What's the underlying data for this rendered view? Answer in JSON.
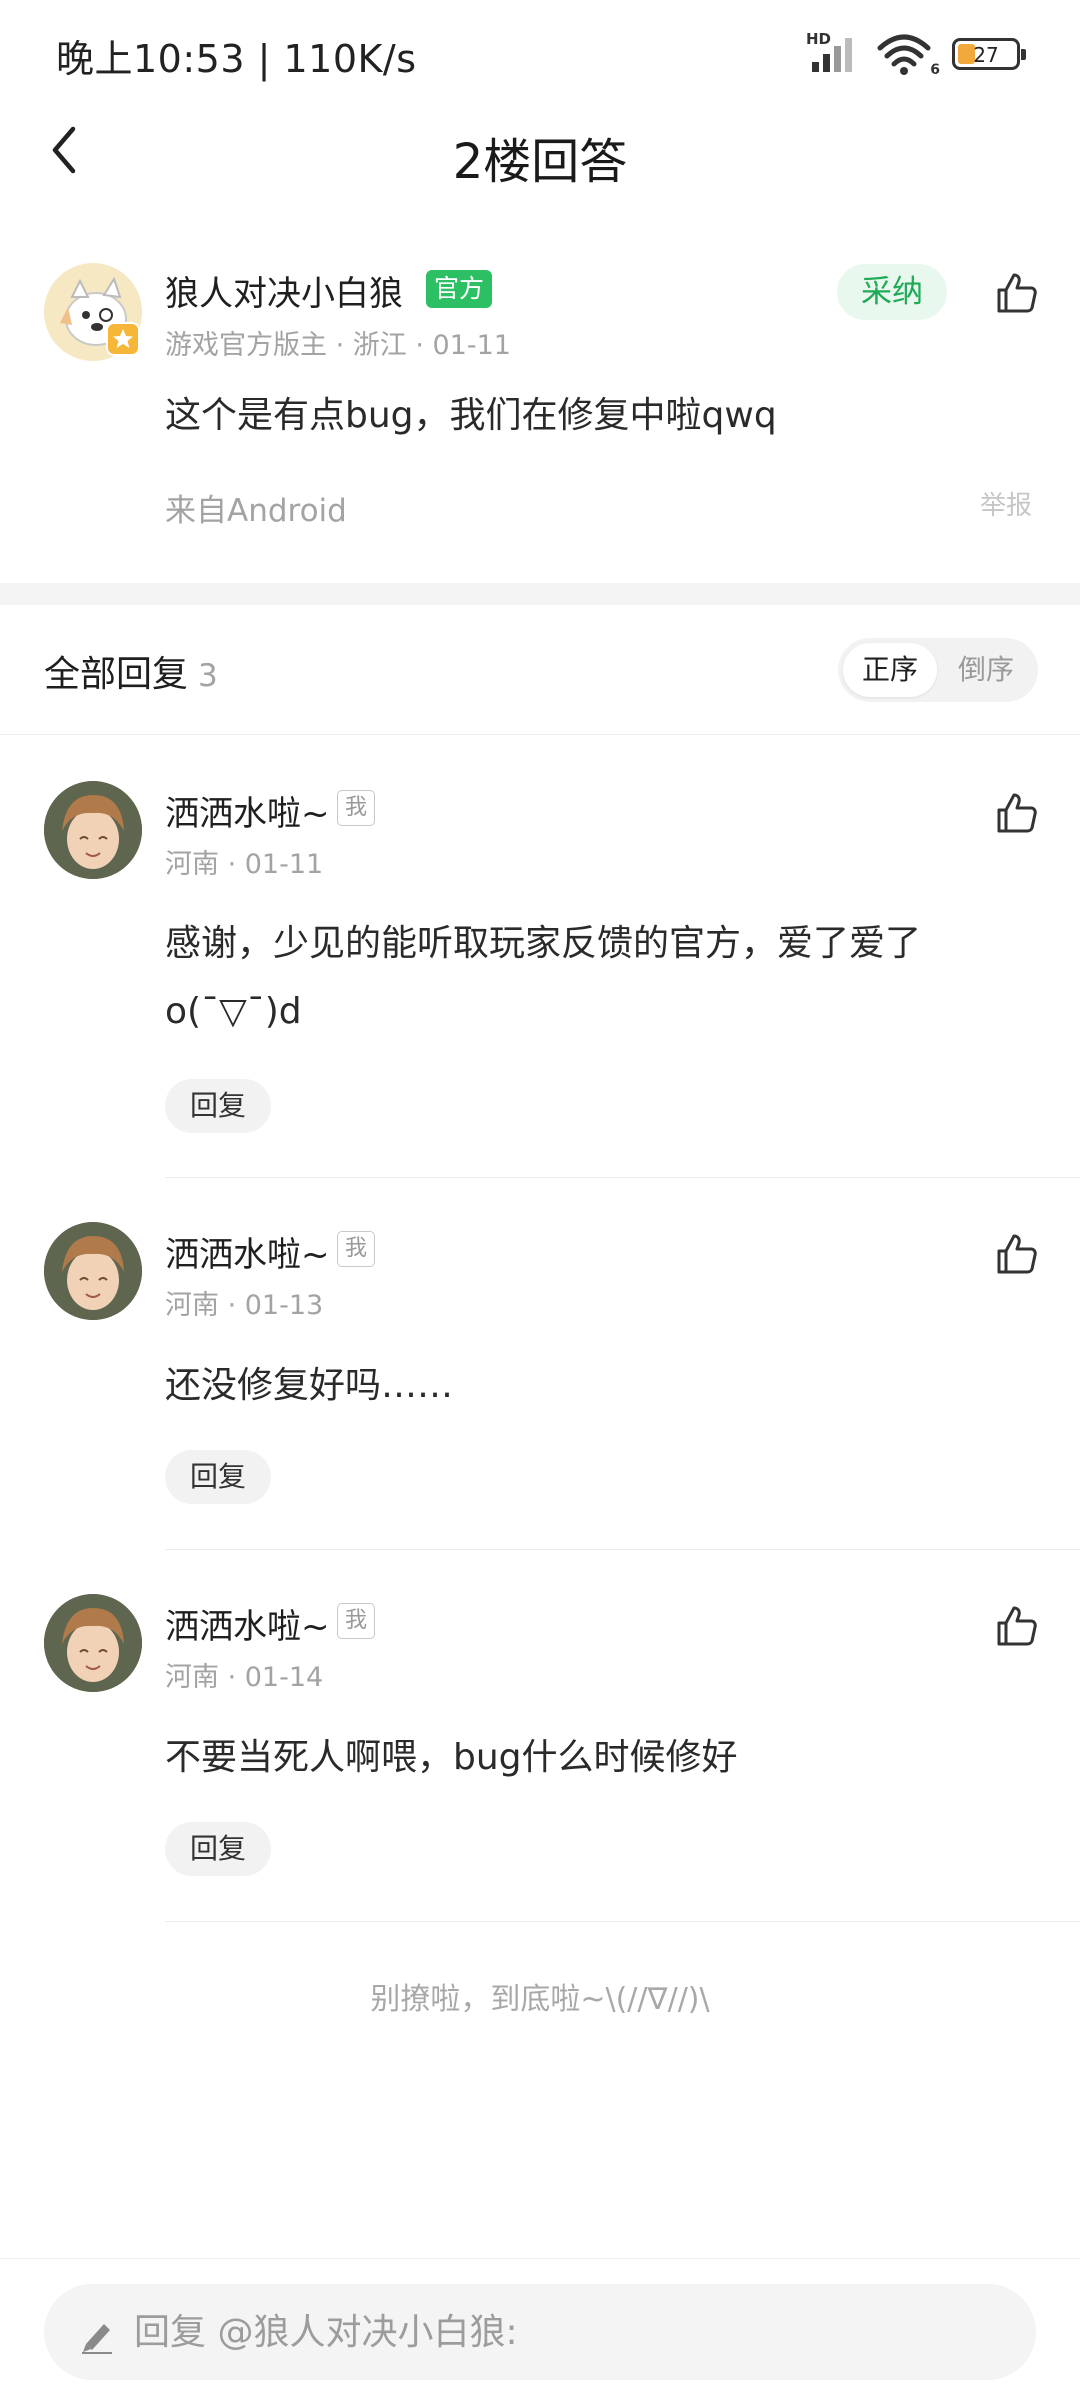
{
  "status_bar": {
    "time": "晚上10:53 | 110K/s",
    "network_badge": "HD",
    "wifi_badge": "6",
    "battery": "27"
  },
  "header": {
    "title": "2楼回答"
  },
  "answer": {
    "author": "狼人对决小白狼",
    "official_badge": "官方",
    "meta": "游戏官方版主 · 浙江 · 01-11",
    "content": "这个是有点bug，我们在修复中啦qwq",
    "source": "来自Android",
    "report_label": "举报",
    "accept_label": "采纳"
  },
  "replies_header": {
    "title": "全部回复",
    "count": "3",
    "sort_asc": "正序",
    "sort_desc": "倒序"
  },
  "replies": [
    {
      "author": "洒洒水啦~",
      "me_tag": "我",
      "meta": "河南 · 01-11",
      "content": "感谢，少见的能听取玩家反馈的官方，爱了爱了o(ˉ▽ˉ)d",
      "reply_label": "回复"
    },
    {
      "author": "洒洒水啦~",
      "me_tag": "我",
      "meta": "河南 · 01-13",
      "content": "还没修复好吗……",
      "reply_label": "回复"
    },
    {
      "author": "洒洒水啦~",
      "me_tag": "我",
      "meta": "河南 · 01-14",
      "content": "不要当死人啊喂，bug什么时候修好",
      "reply_label": "回复"
    }
  ],
  "end_hint": "别撩啦，到底啦~\\(//∇//)\\",
  "reply_input": {
    "placeholder": "回复 @狼人对决小白狼:"
  },
  "colors": {
    "accent_green": "#2dbf64",
    "accept_bg": "#e9f8ee",
    "muted_text": "#a3a3a3"
  }
}
